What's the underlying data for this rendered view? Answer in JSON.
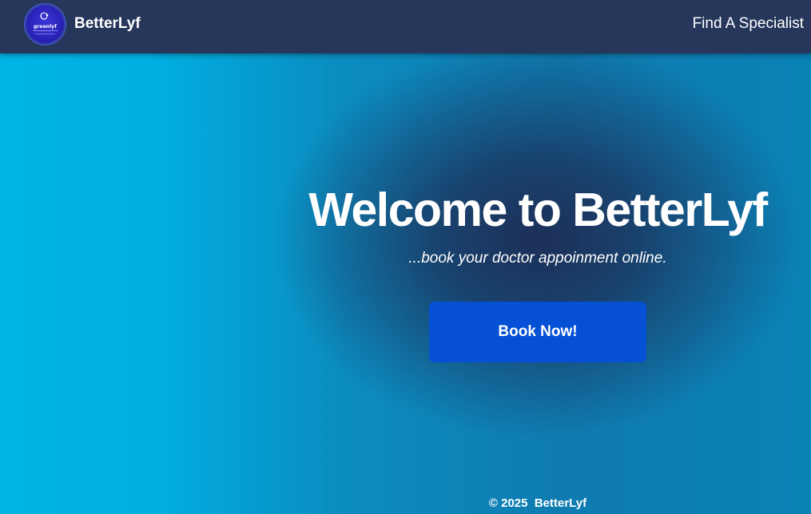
{
  "navbar": {
    "logo_text": "greenlyf",
    "brand": "BetterLyf",
    "links": [
      {
        "label": "Find A Specialist"
      }
    ]
  },
  "hero": {
    "title": "Welcome to BetterLyf",
    "subtitle": "...book your doctor appoinment online.",
    "cta_label": "Book Now!"
  },
  "footer": {
    "text": "© 2025  BetterLyf"
  },
  "colors": {
    "navbar_bg": "#26375b",
    "cta_bg": "#0550d4",
    "hero_light": "#00b4e6",
    "hero_dark": "#1c2f58"
  }
}
